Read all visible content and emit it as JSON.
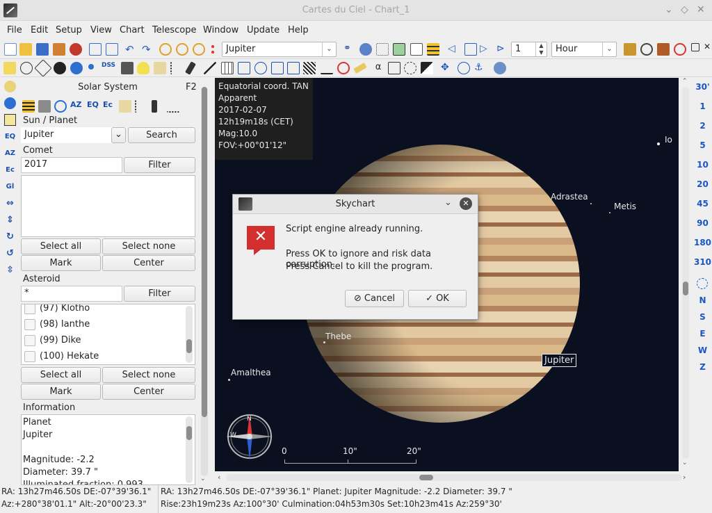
{
  "window": {
    "title": "Cartes du Ciel - Chart_1",
    "minimize_glyph": "⌄",
    "restore_glyph": "◇",
    "close_glyph": "✕"
  },
  "menu": [
    "File",
    "Edit",
    "Setup",
    "View",
    "Chart",
    "Telescope",
    "Window",
    "Update",
    "Help"
  ],
  "toolbar": {
    "object_search_value": "Jupiter",
    "step_value": "1",
    "time_unit": "Hour",
    "tb2_dss_label": "DSS",
    "tb2_alpha_glyph": "α",
    "arrow_down": "⌄"
  },
  "left_column": {
    "eq": "EQ",
    "az": "AZ",
    "ec": "Ec",
    "gl": "Gl"
  },
  "panel": {
    "title": "Solar System",
    "shortcut": "F2",
    "tab_az": "AZ",
    "tab_eq": "EQ",
    "tab_ec": "Ec",
    "sun_planet_label": "Sun / Planet",
    "planet_value": "Jupiter",
    "search_label": "Search",
    "comet_label": "Comet",
    "comet_value": "2017",
    "filter_label": "Filter",
    "select_all": "Select all",
    "select_none": "Select none",
    "mark": "Mark",
    "center": "Center",
    "asteroid_label": "Asteroid",
    "asteroid_value": "*",
    "asteroids": [
      "(97) Klotho",
      "(98) Ianthe",
      "(99) Dike",
      "(100) Hekate"
    ],
    "information_label": "Information",
    "info_lines": [
      "Planet",
      "Jupiter",
      "",
      "Magnitude:   -2.2",
      "Diameter:   39.7 \"",
      "Illuminated fraction:  0.993"
    ]
  },
  "chart": {
    "info": [
      "Equatorial coord. TAN",
      "Apparent",
      "2017-02-07",
      "12h19m18s (CET)",
      "Mag:10.0",
      "FOV:+00°01'12\""
    ],
    "moons": {
      "io": "Io",
      "adrastea": "Adrastea",
      "metis": "Metis",
      "thebe": "Thebe",
      "amalthea": "Amalthea"
    },
    "jupiter_label": "Jupiter",
    "compass_n": "N",
    "compass_w": "W",
    "scale": [
      "0",
      "10\"",
      "20\""
    ]
  },
  "right_column": {
    "fov": [
      "30'",
      "1",
      "2",
      "5",
      "10",
      "20",
      "45",
      "90",
      "180",
      "310"
    ],
    "dirs": [
      "N",
      "S",
      "E",
      "W",
      "Z"
    ]
  },
  "dialog": {
    "title": "Skychart",
    "msg1": "Script engine already running.",
    "msg2": "Press OK to ignore and risk data corruption.",
    "msg3": "Press Cancel to kill the program.",
    "cancel": "Cancel",
    "ok": "OK"
  },
  "status": {
    "l1": "RA: 13h27m46.50s DE:-07°39'36.1\"",
    "l2": "Az:+280°38'01.1\" Alt:-20°00'23.3\"",
    "r1": "RA: 13h27m46.50s DE:-07°39'36.1\"  Planet: Jupiter  Magnitude:  -2.2  Diameter:  39.7 \"",
    "r2": "Rise:23h19m23s Az:100°30'  Culmination:04h53m30s  Set:10h23m41s Az:259°30'"
  },
  "colors": {
    "accent": "#1a56c4",
    "dialog_error": "#d32f2f"
  }
}
